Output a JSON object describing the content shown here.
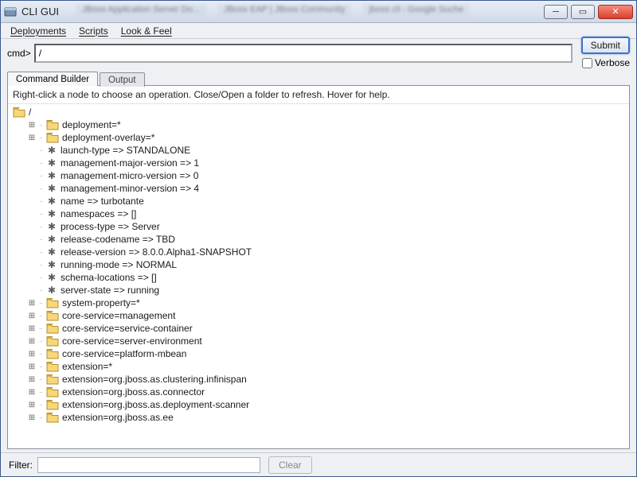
{
  "window": {
    "title": "CLI GUI"
  },
  "menu": {
    "deployments": "Deployments",
    "scripts": "Scripts",
    "look_feel": "Look & Feel"
  },
  "cmd": {
    "label": "cmd>",
    "value": "/"
  },
  "actions": {
    "submit": "Submit",
    "verbose_label": "Verbose",
    "verbose_checked": false
  },
  "tabs": {
    "command_builder": "Command Builder",
    "output": "Output"
  },
  "hint": "Right-click a node to choose an operation.  Close/Open a folder to refresh.  Hover for help.",
  "tree": {
    "root": "/",
    "nodes": [
      {
        "type": "folder",
        "expand": "+",
        "label": "deployment=*"
      },
      {
        "type": "folder",
        "expand": "+",
        "label": "deployment-overlay=*"
      },
      {
        "type": "leaf",
        "label": "launch-type => STANDALONE"
      },
      {
        "type": "leaf",
        "label": "management-major-version => 1"
      },
      {
        "type": "leaf",
        "label": "management-micro-version => 0"
      },
      {
        "type": "leaf",
        "label": "management-minor-version => 4"
      },
      {
        "type": "leaf",
        "label": "name => turbotante"
      },
      {
        "type": "leaf",
        "label": "namespaces => []"
      },
      {
        "type": "leaf",
        "label": "process-type => Server"
      },
      {
        "type": "leaf",
        "label": "release-codename => TBD"
      },
      {
        "type": "leaf",
        "label": "release-version => 8.0.0.Alpha1-SNAPSHOT"
      },
      {
        "type": "leaf",
        "label": "running-mode => NORMAL"
      },
      {
        "type": "leaf",
        "label": "schema-locations => []"
      },
      {
        "type": "leaf",
        "label": "server-state => running"
      },
      {
        "type": "folder",
        "expand": "+",
        "label": "system-property=*"
      },
      {
        "type": "folder",
        "expand": "+",
        "label": "core-service=management"
      },
      {
        "type": "folder",
        "expand": "+",
        "label": "core-service=service-container"
      },
      {
        "type": "folder",
        "expand": "+",
        "label": "core-service=server-environment"
      },
      {
        "type": "folder",
        "expand": "+",
        "label": "core-service=platform-mbean"
      },
      {
        "type": "folder",
        "expand": "+",
        "label": "extension=*"
      },
      {
        "type": "folder",
        "expand": "+",
        "label": "extension=org.jboss.as.clustering.infinispan"
      },
      {
        "type": "folder",
        "expand": "+",
        "label": "extension=org.jboss.as.connector"
      },
      {
        "type": "folder",
        "expand": "+",
        "label": "extension=org.jboss.as.deployment-scanner"
      },
      {
        "type": "folder",
        "expand": "+",
        "label": "extension=org.jboss.as.ee"
      }
    ]
  },
  "filter": {
    "label": "Filter:",
    "value": "",
    "clear": "Clear"
  }
}
